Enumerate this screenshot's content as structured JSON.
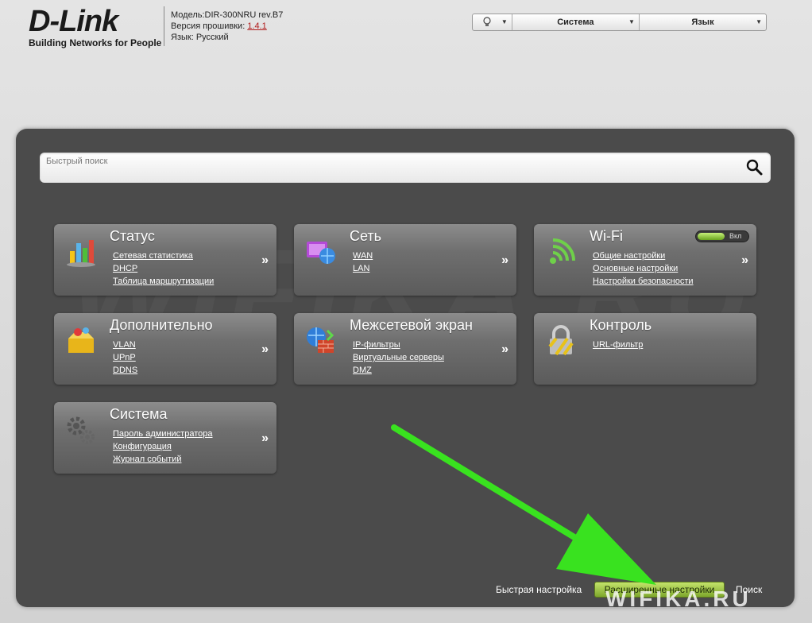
{
  "header": {
    "logo": "D-Link",
    "tagline": "Building Networks for People",
    "model": "Модель:DIR-300NRU rev.B7",
    "firmware_label": "Версия прошивки:",
    "firmware_value": "1.4.1",
    "language_line": "Язык: Русский"
  },
  "topbar": {
    "system_label": "Система",
    "language_label": "Язык"
  },
  "search": {
    "placeholder": "Быстрый поиск"
  },
  "cards": {
    "status": {
      "title": "Статус",
      "links": [
        "Сетевая статистика",
        "DHCP",
        "Таблица маршрутизации"
      ],
      "more": "»"
    },
    "network": {
      "title": "Сеть",
      "links": [
        "WAN",
        "LAN"
      ],
      "more": "»"
    },
    "wifi": {
      "title": "Wi-Fi",
      "links": [
        "Общие настройки",
        "Основные настройки",
        "Настройки безопасности"
      ],
      "more": "»",
      "toggle": "Вкл"
    },
    "advanced": {
      "title": "Дополнительно",
      "links": [
        "VLAN",
        "UPnP",
        "DDNS"
      ],
      "more": "»"
    },
    "firewall": {
      "title": "Межсетевой экран",
      "links": [
        "IP-фильтры",
        "Виртуальные серверы",
        "DMZ"
      ],
      "more": "»"
    },
    "control": {
      "title": "Контроль",
      "links": [
        "URL-фильтр"
      ]
    },
    "system": {
      "title": "Система",
      "links": [
        "Пароль администратора",
        "Конфигурация",
        "Журнал событий"
      ],
      "more": "»"
    }
  },
  "footer": {
    "quick_setup": "Быстрая настройка",
    "advanced_setup": "Расширенные настройки",
    "search": "Поиск"
  },
  "watermark": "WIFIKA.RU",
  "colors": {
    "accent_green": "#7ea82c",
    "annotation_arrow": "#39e21f",
    "panel_bg": "#4b4b4b"
  }
}
